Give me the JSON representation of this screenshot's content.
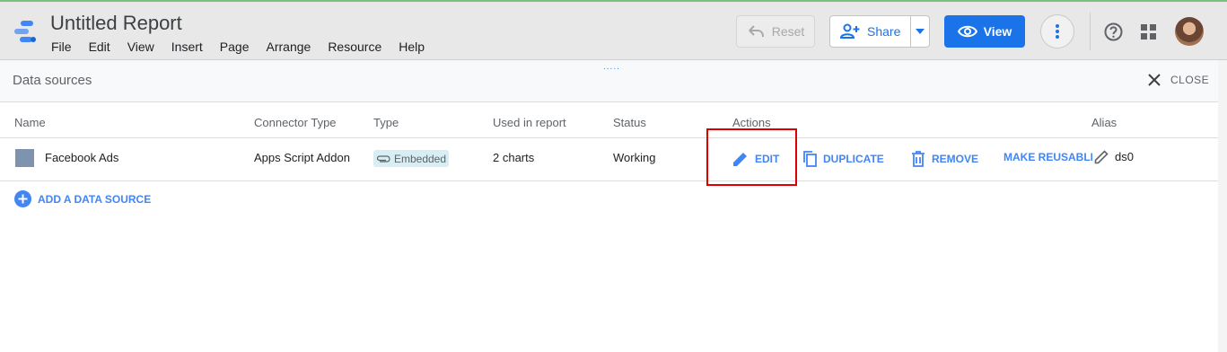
{
  "app": {
    "title": "Untitled Report",
    "menu": [
      "File",
      "Edit",
      "View",
      "Insert",
      "Page",
      "Arrange",
      "Resource",
      "Help"
    ]
  },
  "toolbar": {
    "reset_label": "Reset",
    "share_label": "Share",
    "view_label": "View"
  },
  "panel": {
    "title": "Data sources",
    "close_label": "CLOSE",
    "drag_handle": "....."
  },
  "table": {
    "headers": {
      "name": "Name",
      "connector": "Connector Type",
      "type": "Type",
      "used": "Used in report",
      "status": "Status",
      "actions": "Actions",
      "alias": "Alias"
    },
    "rows": [
      {
        "name": "Facebook Ads",
        "connector": "Apps Script Addon",
        "type": "Embedded",
        "used": "2 charts",
        "status": "Working",
        "alias": "ds0"
      }
    ],
    "actions": {
      "edit": "EDIT",
      "duplicate": "DUPLICATE",
      "remove": "REMOVE",
      "make_reusable": "MAKE REUSABLE"
    }
  },
  "add_data_source_label": "ADD A DATA SOURCE",
  "colors": {
    "accent": "#1a73e8",
    "link": "#4285f4",
    "highlight": "#e00000",
    "topbar": "#e8e8e8"
  }
}
